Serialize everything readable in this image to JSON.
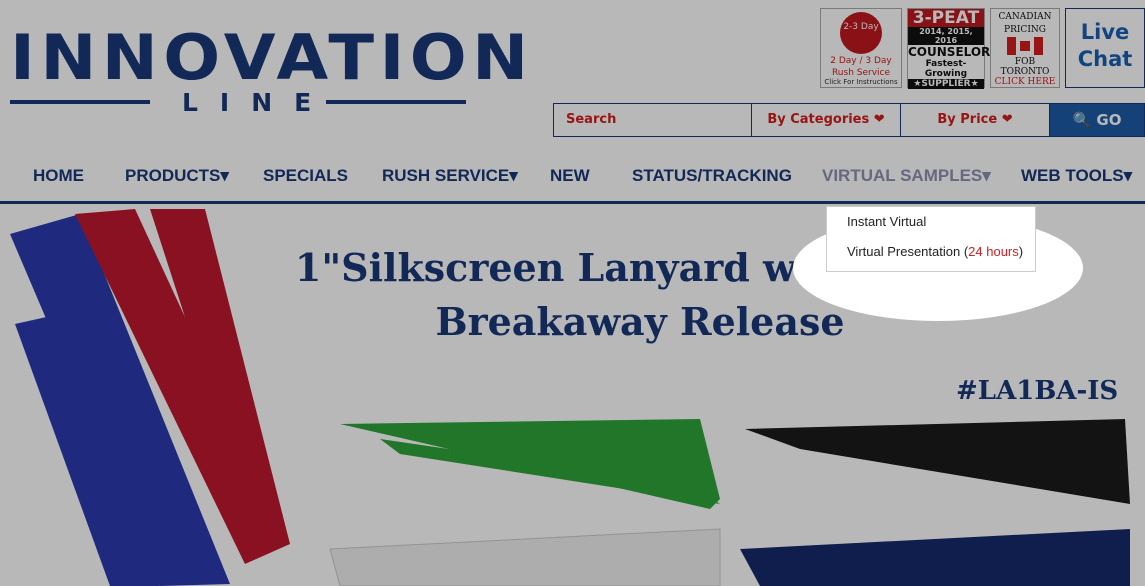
{
  "brand": {
    "name": "INNOVATION",
    "tagline": "LINE"
  },
  "badges": {
    "rush": {
      "day": "2-3 Day",
      "line1": "2 Day / 3 Day",
      "line2": "Rush Service",
      "line3": "Click For Instructions"
    },
    "peat": {
      "big": "3-PEAT",
      "years": "2014, 2015, 2016",
      "counselor": "COUNSELOR",
      "fg": "Fastest-Growing",
      "supplier": "★SUPPLIER★"
    },
    "canadian": {
      "l1": "CANADIAN",
      "l2": "PRICING",
      "l3": "FOB",
      "l4": "TORONTO",
      "l5": "CLICK HERE"
    },
    "chat": {
      "l1": "Live",
      "l2": "Chat"
    }
  },
  "search": {
    "placeholder": "Search",
    "categories": "By Categories ❤",
    "price": "By Price ❤",
    "go": "🔍 GO"
  },
  "nav": [
    {
      "label": "HOME"
    },
    {
      "label": "PRODUCTS▾"
    },
    {
      "label": "SPECIALS"
    },
    {
      "label": "RUSH SERVICE▾"
    },
    {
      "label": "NEW"
    },
    {
      "label": "STATUS/TRACKING"
    },
    {
      "label": "VIRTUAL SAMPLES▾"
    },
    {
      "label": "WEB TOOLS▾"
    }
  ],
  "dropdown": {
    "item1": "Instant Virtual",
    "item2_prefix": "Virtual Presentation (",
    "item2_hours": "24 hours",
    "item2_suffix": ")"
  },
  "hero": {
    "title_line1": "1\"Silkscreen Lanyard with FREE",
    "title_line2": "Breakaway Release",
    "sku": "#LA1BA-IS"
  },
  "colors": {
    "brand": "#1a3a7a",
    "accent": "#d41d1d",
    "go": "#1e5aa8"
  }
}
